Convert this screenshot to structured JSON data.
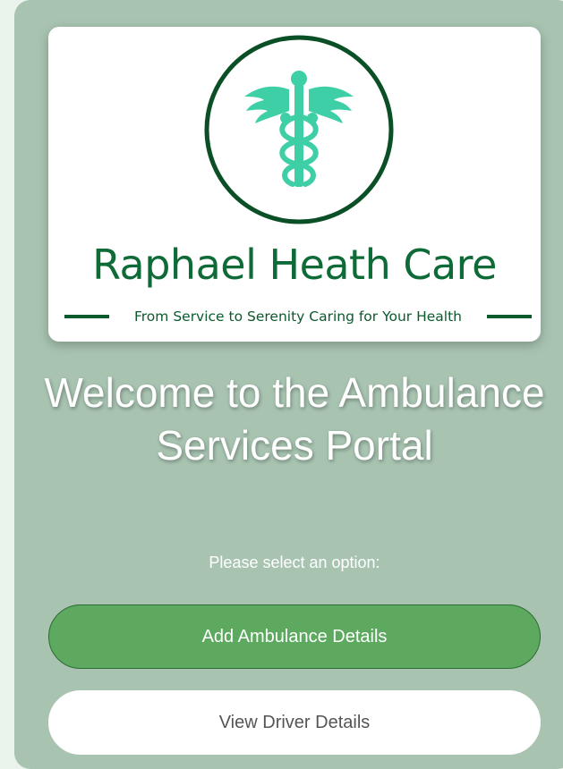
{
  "brand": {
    "name": "Raphael Heath Care",
    "tagline": "From Service to Serenity Caring for Your Health",
    "emblem_icon": "caduceus-icon",
    "colors": {
      "brand_green": "#0e6a36",
      "emblem_teal": "#3ecfa6"
    }
  },
  "main": {
    "heading": "Welcome to the Ambulance Services Portal",
    "prompt": "Please select an option:"
  },
  "actions": {
    "add_ambulance_label": "Add Ambulance Details",
    "view_driver_label": "View Driver Details"
  },
  "colors": {
    "page_background": "#a8c4b1",
    "primary_button": "#5da95f",
    "secondary_button": "#ffffff"
  }
}
